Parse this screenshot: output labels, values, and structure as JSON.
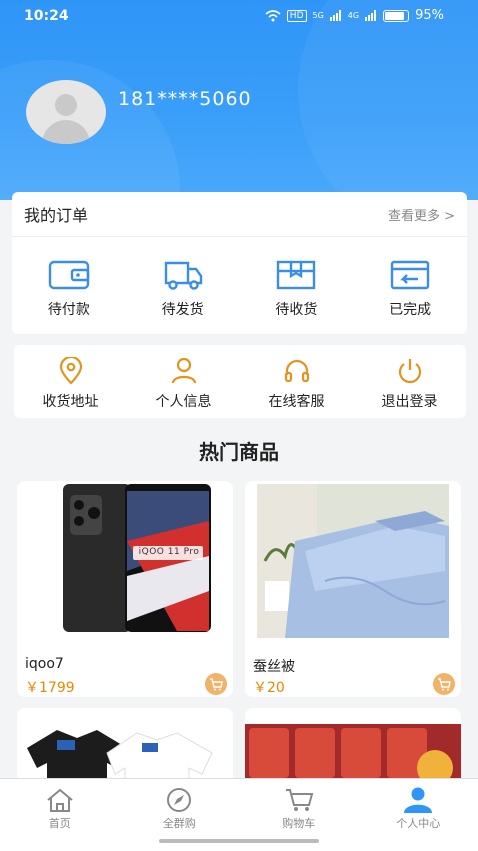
{
  "status_bar": {
    "time": "10:24",
    "network": "HD",
    "signal1": "5G",
    "signal2": "4G",
    "battery": "95%"
  },
  "profile": {
    "phone": "181****5060"
  },
  "orders": {
    "title": "我的订单",
    "more": "查看更多 >",
    "items": [
      {
        "label": "待付款",
        "icon": "wallet-icon"
      },
      {
        "label": "待发货",
        "icon": "truck-icon"
      },
      {
        "label": "待收货",
        "icon": "package-icon"
      },
      {
        "label": "已完成",
        "icon": "return-box-icon"
      }
    ]
  },
  "services": {
    "items": [
      {
        "label": "收货地址",
        "icon": "location-pin-icon"
      },
      {
        "label": "个人信息",
        "icon": "user-icon"
      },
      {
        "label": "在线客服",
        "icon": "headset-icon"
      },
      {
        "label": "退出登录",
        "icon": "power-icon"
      }
    ]
  },
  "hot": {
    "title": "热门商品",
    "products": [
      {
        "name": "iqoo7",
        "price": "￥1799",
        "screen_text": "iQOO 11 Pro"
      },
      {
        "name": "蚕丝被",
        "price": "￥20"
      },
      {
        "name": "",
        "price": ""
      },
      {
        "name": "",
        "price": ""
      }
    ]
  },
  "tabbar": {
    "tabs": [
      {
        "label": "首页",
        "icon": "home-icon"
      },
      {
        "label": "全群购",
        "icon": "compass-icon"
      },
      {
        "label": "购物车",
        "icon": "cart-icon"
      },
      {
        "label": "个人中心",
        "icon": "person-icon"
      }
    ],
    "active": "个人中心"
  },
  "colors": {
    "accent": "#2f95f7",
    "icon_blue": "#3a8ee6",
    "icon_orange": "#e3941f",
    "price": "#e68a00"
  }
}
